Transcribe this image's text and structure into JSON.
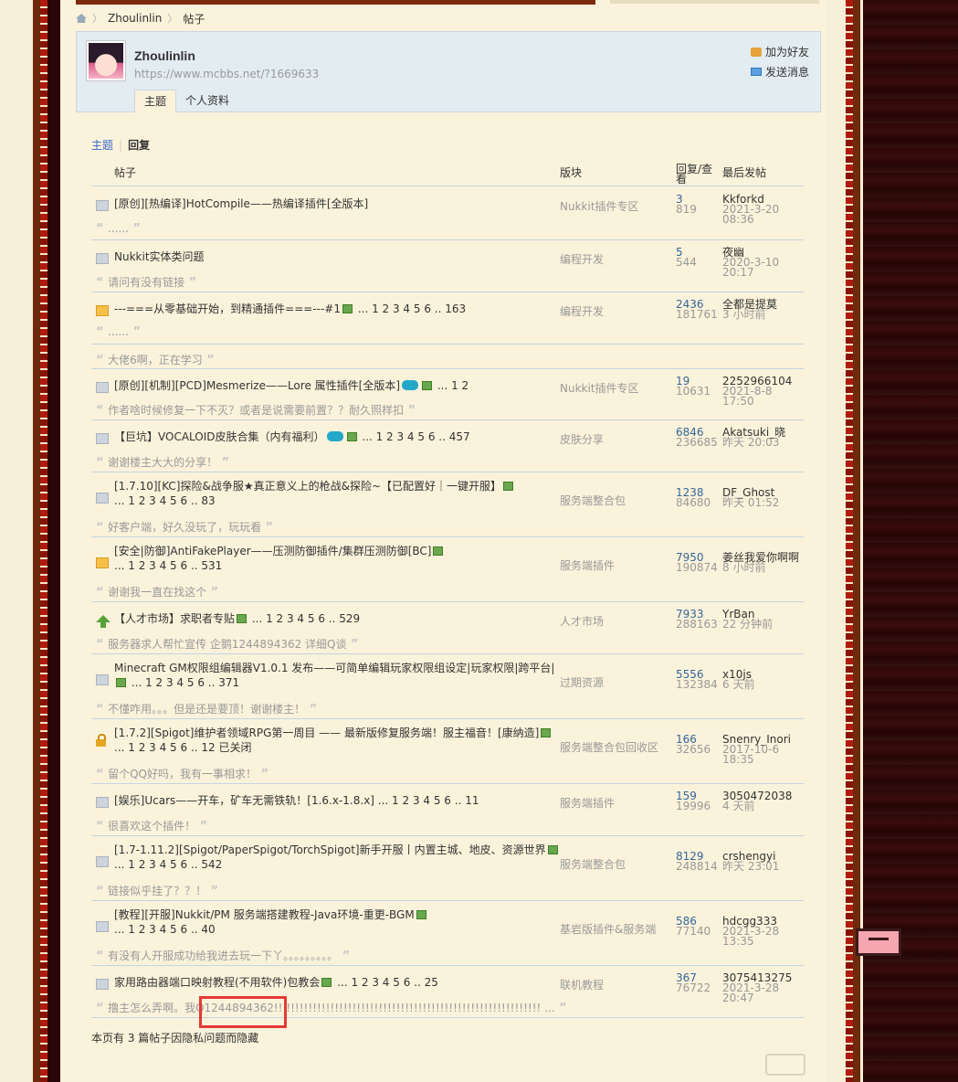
{
  "breadcrumb": {
    "user": "Zhoulinlin",
    "section": "帖子"
  },
  "profile": {
    "name": "Zhoulinlin",
    "url": "https://www.mcbbs.net/?1669633",
    "add_friend": "加为好友",
    "send_message": "发送消息"
  },
  "tabs": [
    {
      "label": "主题",
      "active": true
    },
    {
      "label": "个人资料",
      "active": false
    }
  ],
  "subnav": {
    "topics": "主题",
    "replies": "回复"
  },
  "columns": {
    "post": "帖子",
    "forum": "版块",
    "replies_views": "回复/查看",
    "last_post": "最后发帖"
  },
  "rows": [
    {
      "icon": "document",
      "title": "[原创][热编译]HotCompile——热编译插件[全版本]",
      "pages": "",
      "forum": "Nukkit插件专区",
      "replies": "3",
      "views": "819",
      "last_user": "Kkforkd",
      "last_time": "2021-3-20 08:36",
      "quote": "......"
    },
    {
      "icon": "document",
      "title": "Nukkit实体类问题",
      "pages": "",
      "forum": "编程开发",
      "replies": "5",
      "views": "544",
      "last_user": "夜幽",
      "last_time": "2020-3-10 20:17",
      "quote": "请问有没有链接"
    },
    {
      "icon": "folder",
      "title": "---===从零基础开始，到精通插件===---#1",
      "pages": "... 1 2 3 4 5 6 .. 163",
      "forum": "编程开发",
      "replies": "2436",
      "views": "181761",
      "last_user": "全都是提莫",
      "last_time": "3 小时前",
      "quote": "......",
      "quote2": "大佬6啊，正在学习"
    },
    {
      "icon": "document",
      "title": "[原创][机制][PCD]Mesmerize——Lore 属性插件[全版本]",
      "pages": "... 1 2",
      "forum": "Nukkit插件专区",
      "replies": "19",
      "views": "10631",
      "last_user": "2252966104",
      "last_time": "2021-8-8 17:50",
      "quote": "作者啥时候修复一下不灭？或者是说需要前置？？耐久照样扣"
    },
    {
      "icon": "document",
      "title": "【巨坑】VOCALOID皮肤合集（内有福利）",
      "pages": "... 1 2 3 4 5 6 .. 457",
      "forum": "皮肤分享",
      "replies": "6846",
      "views": "236685",
      "last_user": "Akatsuki_晓",
      "last_time": "昨天 20:03",
      "quote": "谢谢楼主大大的分享！"
    },
    {
      "icon": "document",
      "title": "[1.7.10][KC]探险&战争服★真正意义上的枪战&探险~【已配置好｜一键开服】",
      "pages": "... 1 2 3 4 5 6 .. 83",
      "forum": "服务端整合包",
      "replies": "1238",
      "views": "84680",
      "last_user": "DF_Ghost",
      "last_time": "昨天 01:52",
      "quote": "好客户端，好久没玩了，玩玩看"
    },
    {
      "icon": "folder",
      "title": "[安全|防御]AntiFakePlayer——压测防御插件/集群压测防御[BC]",
      "pages": "... 1 2 3 4 5 6 .. 531",
      "forum": "服务端插件",
      "replies": "7950",
      "views": "190874",
      "last_user": "姜丝我爱你啊啊",
      "last_time": "8 小时前",
      "quote": "谢谢我一直在找这个"
    },
    {
      "icon": "up-arrow",
      "title": "【人才市场】求职者专贴",
      "pages": "... 1 2 3 4 5 6 .. 529",
      "forum": "人才市场",
      "replies": "7933",
      "views": "288163",
      "last_user": "YrBan",
      "last_time": "22 分钟前",
      "quote": "服务器求人帮忙宣传 企鹅1244894362 详细Q谈"
    },
    {
      "icon": "document",
      "title": "Minecraft GM权限组编辑器V1.0.1 发布——可简单编辑玩家权限组设定|玩家权限|跨平台|",
      "pages": "... 1 2 3 4 5 6 .. 371",
      "forum": "过期资源",
      "replies": "5556",
      "views": "132384",
      "last_user": "x10js",
      "last_time": "6 天前",
      "quote": "不懂咋用。。。但是还是要顶！谢谢楼主！"
    },
    {
      "icon": "lock",
      "title": "[1.7.2][Spigot]维护者领域RPG第一周目 —— 最新版修复服务端！服主福音！[康纳造]",
      "pages": "... 1 2 3 4 5 6 .. 12  已关闭",
      "forum": "服务端整合包回收区",
      "replies": "166",
      "views": "32656",
      "last_user": "Snenry_Inori",
      "last_time": "2017-10-6 18:35",
      "quote": "留个QQ好吗，我有一事相求！"
    },
    {
      "icon": "document",
      "title": "[娱乐]Ucars——开车，矿车无需铁轨！[1.6.x-1.8.x]",
      "pages": "... 1 2 3 4 5 6 .. 11",
      "forum": "服务端插件",
      "replies": "159",
      "views": "19996",
      "last_user": "3050472038",
      "last_time": "4 天前",
      "quote": "很喜欢这个插件！"
    },
    {
      "icon": "document",
      "title": "[1.7-1.11.2][Spigot/PaperSpigot/TorchSpigot]新手开服丨内置主城、地皮、资源世界",
      "pages": "... 1 2 3 4 5 6 .. 542",
      "forum": "服务端整合包",
      "replies": "8129",
      "views": "248814",
      "last_user": "crshengyi",
      "last_time": "昨天 23:01",
      "quote": "链接似乎挂了？？！"
    },
    {
      "icon": "document",
      "title": "[教程][开服]Nukkit/PM 服务端搭建教程-Java环境-重更-BGM",
      "pages": "... 1 2 3 4 5 6 .. 40",
      "forum": "基岩版插件&服务端",
      "replies": "586",
      "views": "77140",
      "last_user": "hdcgg333",
      "last_time": "2021-3-28 13:35",
      "quote": "有没有人开服成功给我进去玩一下丫。。。。。。。。。"
    },
    {
      "icon": "document",
      "title": "家用路由器端口映射教程(不用软件)包教会",
      "pages": "... 1 2 3 4 5 6 .. 25",
      "forum": "联机教程",
      "replies": "367",
      "views": "76722",
      "last_user": "3075413275",
      "last_time": "2021-3-28 20:47",
      "quote": "撸主怎么弄啊。我Q1244894362!!  !!!!!!!!!!!!!!!!!!!!!!!!!!!!!!!!!!!!!!!!!!!!!!!!!!!!!!!!!! ..."
    }
  ],
  "hidden_notice": "本页有 3 篇帖子因隐私问题而隐藏"
}
